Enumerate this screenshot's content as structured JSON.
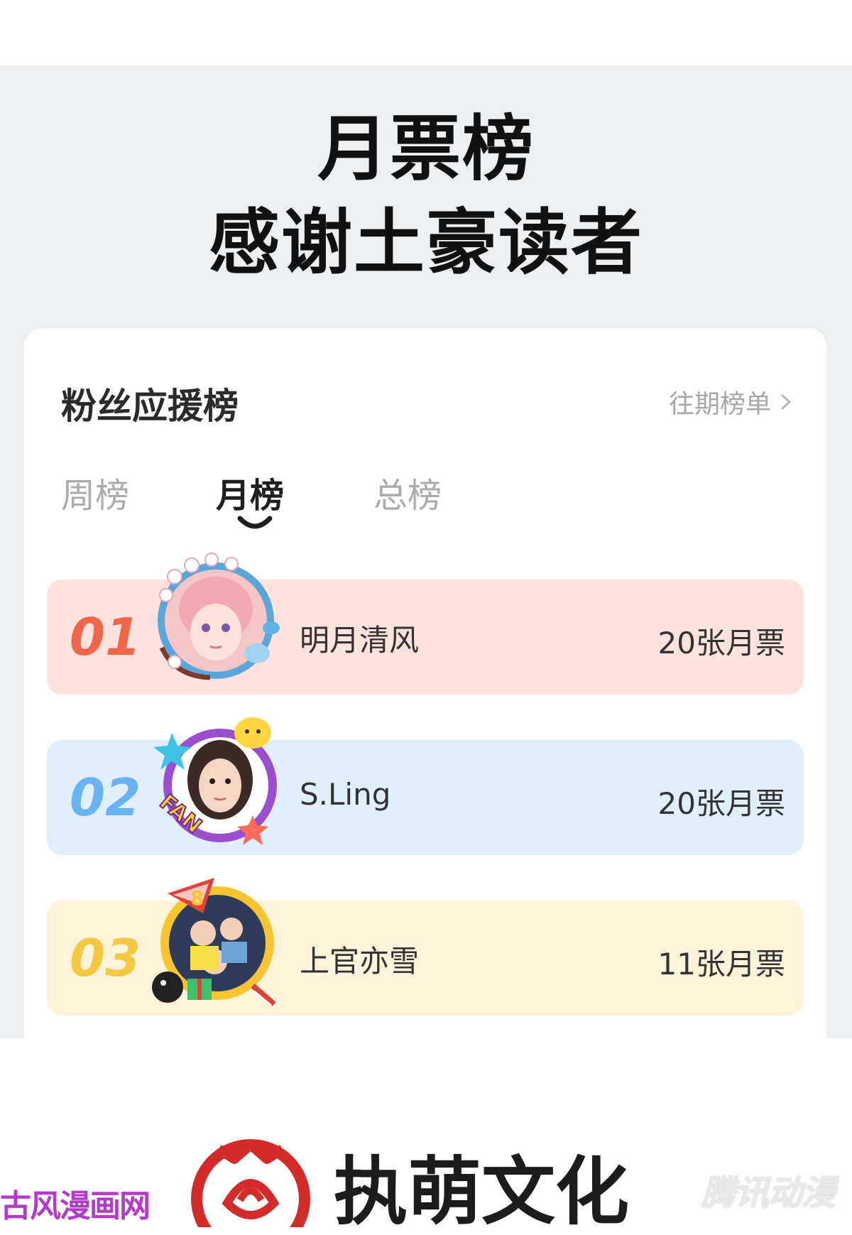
{
  "headline": {
    "line1": "月票榜",
    "line2": "感谢土豪读者"
  },
  "card": {
    "title": "粉丝应援榜",
    "history_link": "往期榜单"
  },
  "tabs": [
    {
      "label": "周榜",
      "active": false
    },
    {
      "label": "月榜",
      "active": true
    },
    {
      "label": "总榜",
      "active": false
    }
  ],
  "ranking": [
    {
      "rank": "01",
      "name": "明月清风",
      "votes": "20张月票",
      "color": "#f0664b",
      "bg": "#fde2dd"
    },
    {
      "rank": "02",
      "name": "S.Ling",
      "votes": "20张月票",
      "color": "#6ab3f2",
      "bg": "#e1eefc"
    },
    {
      "rank": "03",
      "name": "上官亦雪",
      "votes": "11张月票",
      "color": "#f5c842",
      "bg": "#fdf3d8"
    }
  ],
  "footer": {
    "left_watermark": "古风漫画网",
    "brand": "执萌文化",
    "right_watermark": "腾讯动漫"
  },
  "icons": {
    "history_arrow": "chevron-right-icon",
    "tab_indicator": "smile-arc-icon",
    "brand_logo": "rose-circle-logo"
  }
}
